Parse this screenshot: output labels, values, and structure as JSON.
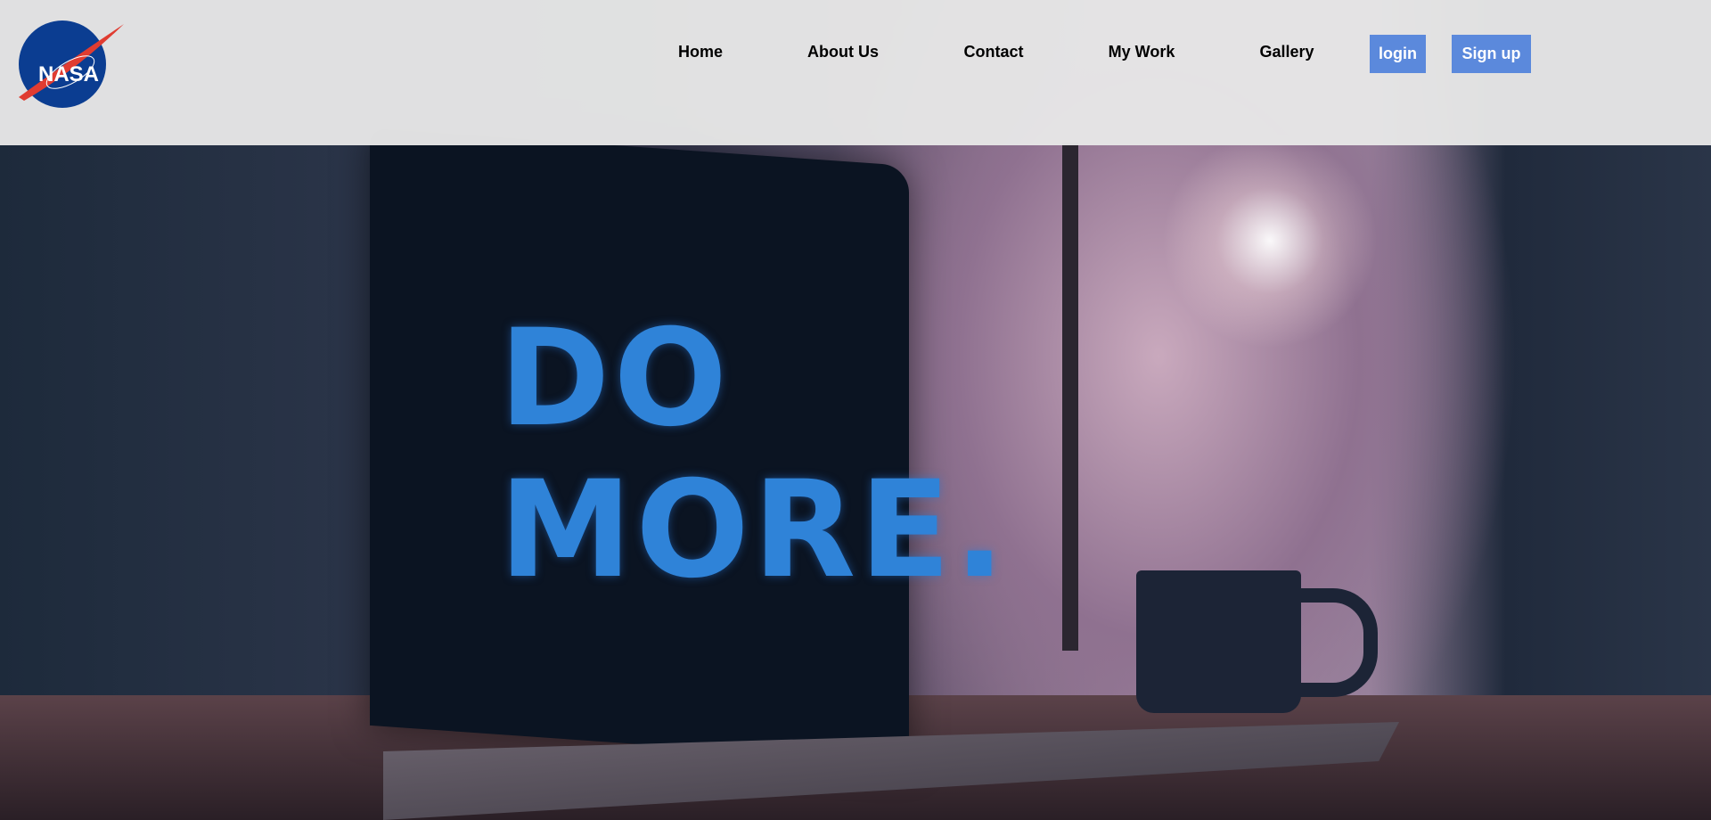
{
  "header": {
    "logo_text": "NASA",
    "nav": [
      {
        "label": "Home"
      },
      {
        "label": "About Us"
      },
      {
        "label": "Contact"
      },
      {
        "label": "My Work"
      },
      {
        "label": "Gallery"
      }
    ],
    "login_label": "login",
    "signup_label": "Sign up",
    "button_color": "#5b89dc"
  },
  "hero": {
    "screen_text_line1": "DO",
    "screen_text_line2": "MORE."
  }
}
